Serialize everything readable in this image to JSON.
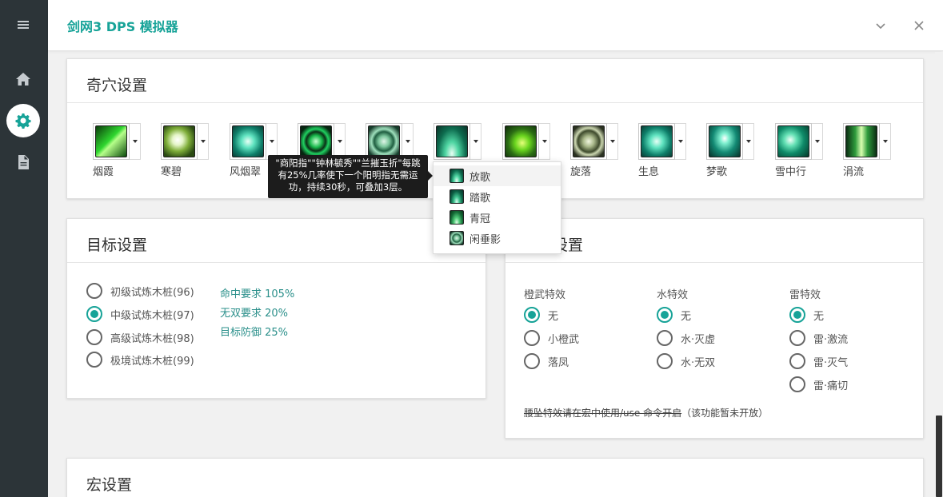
{
  "header": {
    "title": "剑网3 DPS 模拟器",
    "collapse_icon": "chevron-down-icon",
    "close_icon": "close-icon"
  },
  "sidebar": {
    "items": [
      {
        "name": "menu",
        "icon": "menu-icon"
      },
      {
        "name": "home",
        "icon": "home-icon"
      },
      {
        "name": "settings",
        "icon": "gear-icon",
        "active": true
      },
      {
        "name": "document",
        "icon": "document-icon"
      }
    ]
  },
  "talents_card": {
    "title": "奇穴设置",
    "items": [
      {
        "name": "烟霞"
      },
      {
        "name": "寒碧"
      },
      {
        "name": "风烟翠"
      },
      {
        "name": ""
      },
      {
        "name": ""
      },
      {
        "name": ""
      },
      {
        "name": ""
      },
      {
        "name": "旋落"
      },
      {
        "name": "生息"
      },
      {
        "name": "梦歌"
      },
      {
        "name": "雪中行"
      },
      {
        "name": "涓流"
      }
    ],
    "tooltip": "\"商阳指\"\"钟林毓秀\"\"兰摧玉折\"每跳有25%几率使下一个阳明指无需运功，持续30秒，可叠加3层。",
    "dropdown": [
      "放歌",
      "踏歌",
      "青冠",
      "闲垂影"
    ]
  },
  "target_card": {
    "title": "目标设置",
    "options": [
      {
        "label": "初级试炼木桩(96)",
        "checked": false
      },
      {
        "label": "中级试炼木桩(97)",
        "checked": true
      },
      {
        "label": "高级试炼木桩(98)",
        "checked": false
      },
      {
        "label": "极境试炼木桩(99)",
        "checked": false
      }
    ],
    "info": [
      "命中要求 105%",
      "无双要求 20%",
      "目标防御 25%"
    ]
  },
  "effects_card": {
    "title": "设置",
    "columns": [
      {
        "head": "橙武特效",
        "options": [
          {
            "label": "无",
            "checked": true
          },
          {
            "label": "小橙武",
            "checked": false
          },
          {
            "label": "落凤",
            "checked": false
          }
        ]
      },
      {
        "head": "水特效",
        "options": [
          {
            "label": "无",
            "checked": true
          },
          {
            "label": "水·灭虚",
            "checked": false
          },
          {
            "label": "水·无双",
            "checked": false
          }
        ]
      },
      {
        "head": "雷特效",
        "options": [
          {
            "label": "无",
            "checked": true
          },
          {
            "label": "雷·激流",
            "checked": false
          },
          {
            "label": "雷·灭气",
            "checked": false
          },
          {
            "label": "雷·痛切",
            "checked": false
          }
        ]
      }
    ],
    "note_struck": "腰坠特效请在宏中使用/use 命令开启",
    "note_tail": "（该功能暂未开放）"
  },
  "macro_card": {
    "title": "宏设置"
  },
  "colors": {
    "accent": "#17a398",
    "sidebar": "#2c3438"
  }
}
